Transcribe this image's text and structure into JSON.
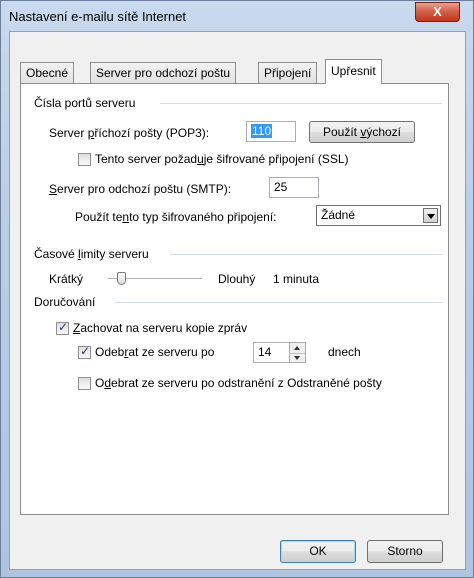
{
  "window": {
    "title": "Nastavení e-mailu sítě Internet",
    "close_label": "X"
  },
  "tabs": [
    {
      "label": "Obecné"
    },
    {
      "label": "Server pro odchozí poštu"
    },
    {
      "label": "Připojení"
    },
    {
      "label": "Upřesnit",
      "active": true
    }
  ],
  "ports": {
    "group_title": "Čísla portů serveru",
    "incoming_label_pre": "Server ",
    "incoming_label_u": "p",
    "incoming_label_post": "říchozí pošty (POP3):",
    "incoming_value": "110",
    "use_default_pre": "Použít ",
    "use_default_u": "v",
    "use_default_post": "ýchozí",
    "ssl_pre": "Tento server požad",
    "ssl_u": "u",
    "ssl_post": "je šifrované připojení (SSL)",
    "ssl_checked": false,
    "outgoing_pre": "",
    "outgoing_u": "S",
    "outgoing_post": "erver pro odchozí poštu (SMTP):",
    "outgoing_value": "25",
    "enc_pre": "Použít te",
    "enc_u": "n",
    "enc_post": "to typ šifrovaného připojení:",
    "enc_value": "Žádné"
  },
  "timeouts": {
    "group_title_pre": "Časové ",
    "group_title_u": "l",
    "group_title_post": "imity serveru",
    "short_label": "Krátký",
    "long_label": "Dlouhý",
    "value_text": "1 minuta",
    "slider_fraction": 0.1
  },
  "delivery": {
    "group_title": "Doručování",
    "keep_pre": "",
    "keep_u": "Z",
    "keep_post": "achovat na serveru kopie zpráv",
    "keep_checked": true,
    "remove_pre": "Odeb",
    "remove_u": "r",
    "remove_post": "at ze serveru po",
    "remove_checked": true,
    "remove_days": "14",
    "days_label": "dnech",
    "remove_deleted_pre": "O",
    "remove_deleted_u": "d",
    "remove_deleted_post": "ebrat ze serveru po odstranění z Odstraněné pošty",
    "remove_deleted_checked": false
  },
  "buttons": {
    "ok": "OK",
    "cancel": "Storno"
  }
}
